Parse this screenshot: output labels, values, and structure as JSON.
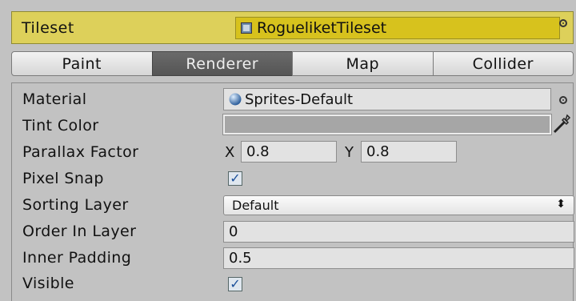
{
  "tileset": {
    "label": "Tileset",
    "value": "RogueliketTileset"
  },
  "tabs": [
    "Paint",
    "Renderer",
    "Map",
    "Collider"
  ],
  "active_tab": "Renderer",
  "fields": {
    "material": {
      "label": "Material",
      "value": "Sprites-Default"
    },
    "tint": {
      "label": "Tint Color"
    },
    "parallax": {
      "label": "Parallax Factor",
      "x_label": "X",
      "x_value": "0.8",
      "y_label": "Y",
      "y_value": "0.8"
    },
    "pixel_snap": {
      "label": "Pixel Snap",
      "checked": true
    },
    "sorting_layer": {
      "label": "Sorting Layer",
      "value": "Default"
    },
    "order_in_layer": {
      "label": "Order In Layer",
      "value": "0"
    },
    "inner_padding": {
      "label": "Inner Padding",
      "value": "0.5"
    },
    "visible": {
      "label": "Visible",
      "checked": true
    }
  },
  "colors": {
    "tileset_bg": "#ddd05a",
    "tileset_field": "#d7c21d",
    "panel": "#c2c2c2",
    "active_tab": "#5c5c5c",
    "tint_color": "#a6a6a6"
  }
}
